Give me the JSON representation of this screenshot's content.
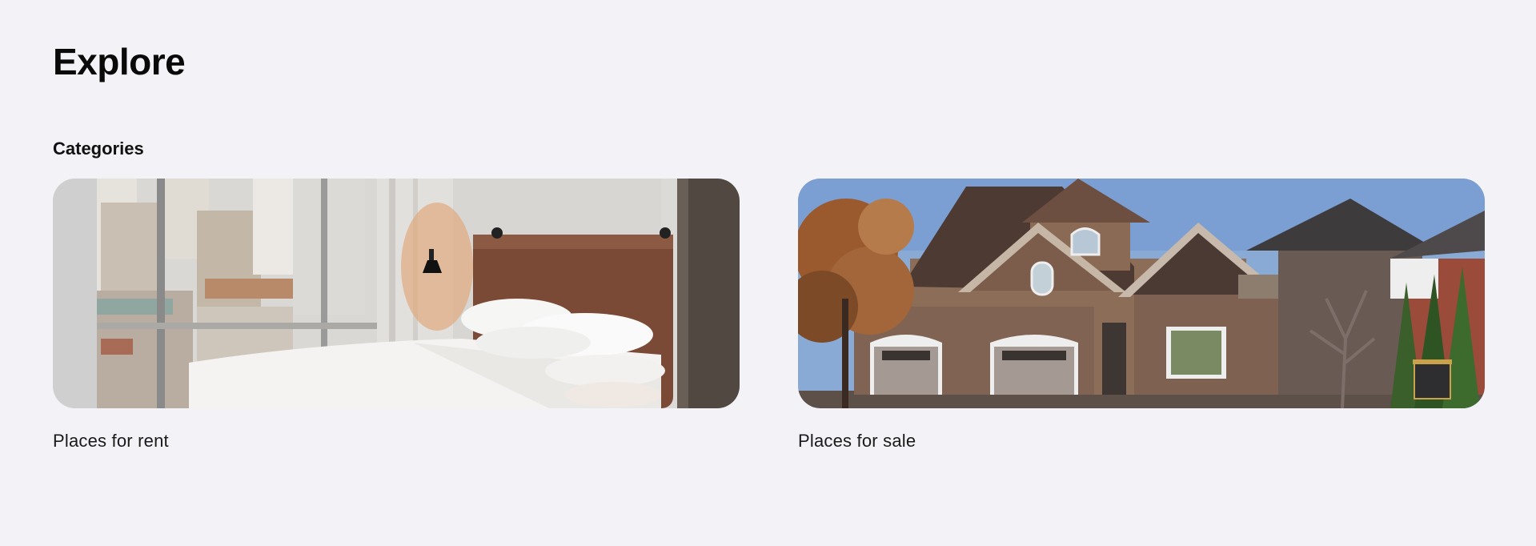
{
  "page": {
    "title": "Explore"
  },
  "categories": {
    "heading": "Categories",
    "items": [
      {
        "label": "Places for rent",
        "image": "bedroom-photo"
      },
      {
        "label": "Places for sale",
        "image": "house-photo"
      }
    ]
  }
}
